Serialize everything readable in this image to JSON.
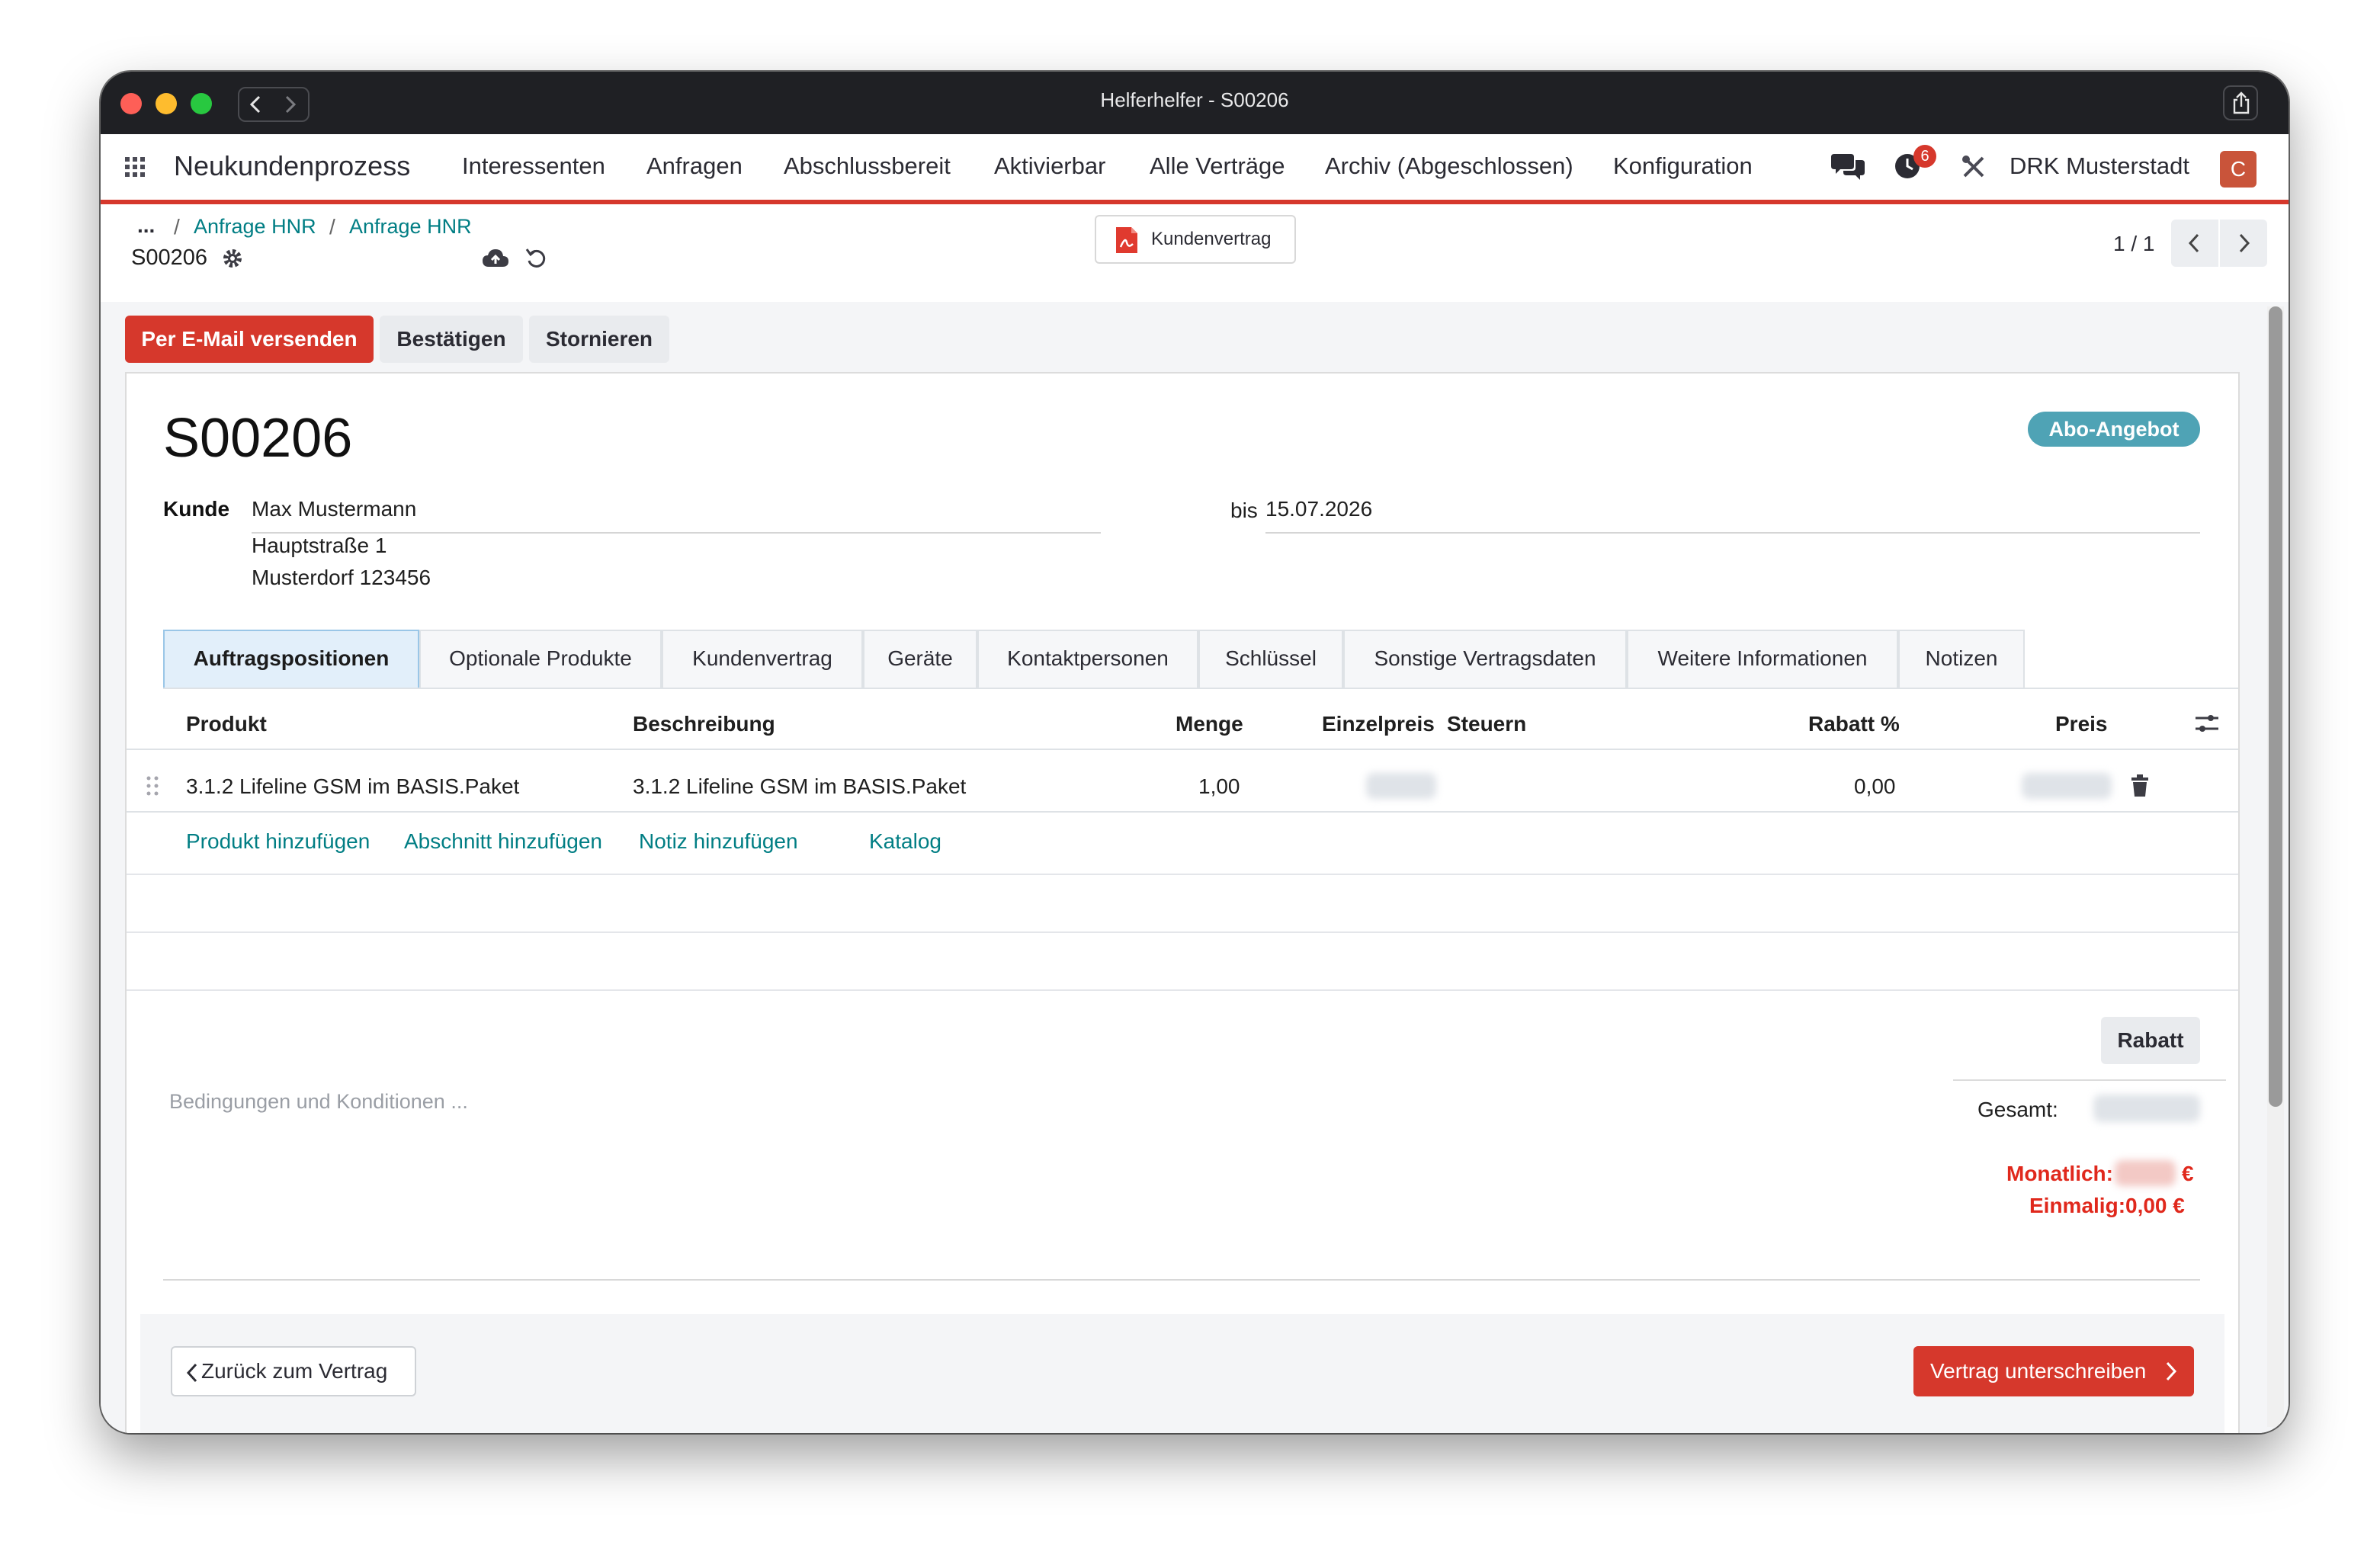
{
  "window": {
    "title": "Helferhelfer - S00206"
  },
  "navbar": {
    "app_name": "Neukundenprozess",
    "menu": [
      "Interessenten",
      "Anfragen",
      "Abschlussbereit",
      "Aktivierbar",
      "Alle Verträge",
      "Archiv (Abgeschlossen)",
      "Konfiguration"
    ],
    "activity_count": "6",
    "company": "DRK Musterstadt",
    "avatar_letter": "C"
  },
  "breadcrumb": {
    "ellipsis": "...",
    "items": [
      "Anfrage HNR",
      "Anfrage HNR"
    ],
    "record": "S00206"
  },
  "report_button": "Kundenvertrag",
  "pager": {
    "value": "1 / 1"
  },
  "actions": {
    "send_email": "Per E-Mail versenden",
    "confirm": "Bestätigen",
    "cancel": "Stornieren"
  },
  "record": {
    "name": "S00206",
    "badge": "Abo-Angebot",
    "customer_label": "Kunde",
    "customer_name": "Max Mustermann",
    "address_line1": "Hauptstraße 1",
    "address_line2": "Musterdorf 123456",
    "until_label": "bis",
    "until_date": "15.07.2026"
  },
  "tabs": [
    "Auftragspositionen",
    "Optionale Produkte",
    "Kundenvertrag",
    "Geräte",
    "Kontaktpersonen",
    "Schlüssel",
    "Sonstige Vertragsdaten",
    "Weitere Informationen",
    "Notizen"
  ],
  "lines_table": {
    "headers": {
      "product": "Produkt",
      "description": "Beschreibung",
      "quantity": "Menge",
      "unit_price": "Einzelpreis",
      "taxes": "Steuern",
      "discount": "Rabatt %",
      "price": "Preis"
    },
    "rows": [
      {
        "product": "3.1.2 Lifeline GSM im BASIS.Paket",
        "description": "3.1.2 Lifeline GSM im BASIS.Paket",
        "quantity": "1,00",
        "discount": "0,00"
      }
    ],
    "add_product": "Produkt hinzufügen",
    "add_section": "Abschnitt hinzufügen",
    "add_note": "Notiz hinzufügen",
    "catalog": "Katalog"
  },
  "footer": {
    "terms_placeholder": "Bedingungen und Konditionen ...",
    "discount_button": "Rabatt",
    "total_label": "Gesamt:",
    "monthly_label": "Monatlich:",
    "monthly_currency": "€",
    "once_label": "Einmalig:",
    "once_value": "0,00 €"
  },
  "bottom_actions": {
    "back": "Zurück zum Vertrag",
    "sign": "Vertrag unterschreiben"
  },
  "colors": {
    "brand_red": "#d6382c",
    "link_teal": "#017e84",
    "badge": "#4fa3b5",
    "tab_active_bg": "#e2effa"
  }
}
